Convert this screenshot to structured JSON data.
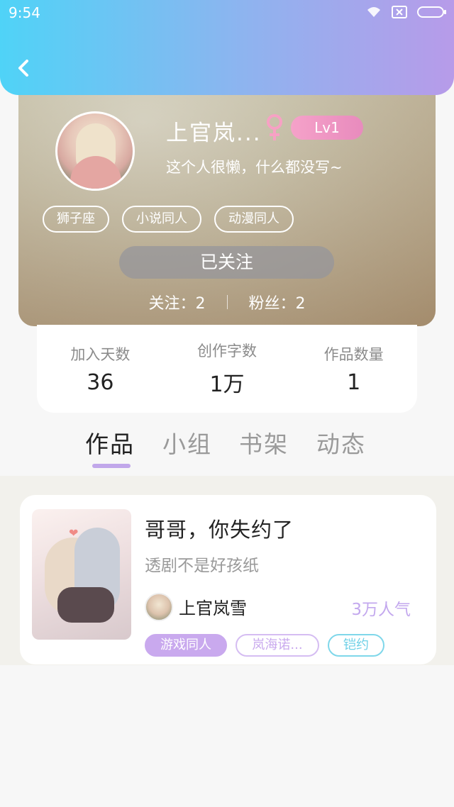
{
  "status_bar": {
    "time": "9:54"
  },
  "profile": {
    "name": "上官岚...",
    "level": "Lv1",
    "bio": "这个人很懒，什么都没写~",
    "tags": [
      "狮子座",
      "小说同人",
      "动漫同人"
    ],
    "follow_button": "已关注",
    "following": "关注：2",
    "fans": "粉丝：2"
  },
  "stats": [
    {
      "label": "加入天数",
      "value": "36"
    },
    {
      "label": "创作字数",
      "value": "1万"
    },
    {
      "label": "作品数量",
      "value": "1"
    }
  ],
  "tabs": [
    "作品",
    "小组",
    "书架",
    "动态"
  ],
  "active_tab": "作品",
  "work": {
    "title": "哥哥，你失约了",
    "subtitle": "透剧不是好孩纸",
    "author": "上官岚雪",
    "popularity": "3万人气",
    "tags": [
      "游戏同人",
      "岚海诺...",
      "铠约"
    ]
  },
  "colors": {
    "header_gradient_start": "#4fd3f7",
    "header_gradient_end": "#b79be9",
    "accent_purple": "#c1a7ea",
    "level_pink": "#e88bbd",
    "tag_cyan": "#6fd1e7"
  },
  "icons": [
    "back-arrow-icon",
    "wifi-icon",
    "sim-icon",
    "battery-icon",
    "female-gender-icon"
  ]
}
